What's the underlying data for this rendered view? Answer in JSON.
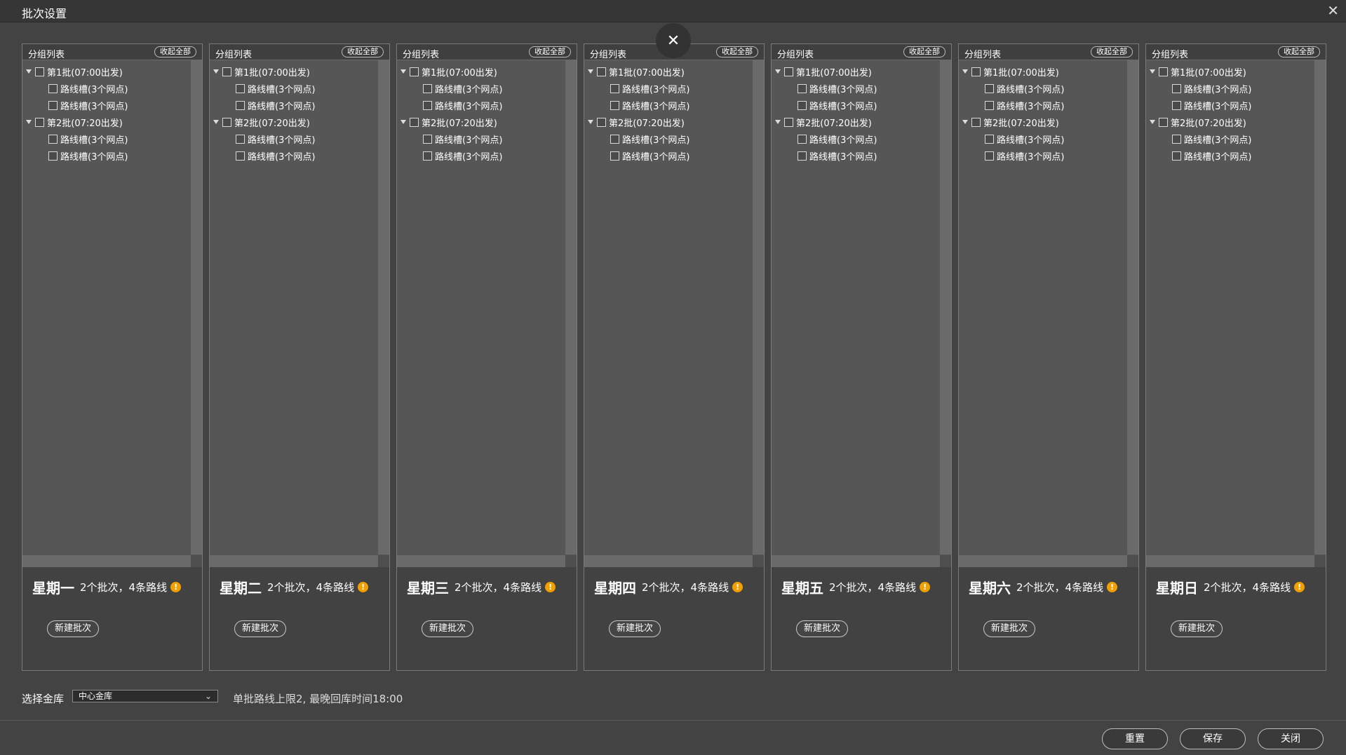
{
  "window": {
    "title": "批次设置",
    "close_glyph": "✕",
    "center_close_glyph": "✕"
  },
  "days": [
    {
      "header_title": "分组列表",
      "collapse_label": "收起全部",
      "batches": [
        {
          "label": "第1批(07:00出发)",
          "routes": [
            "路线槽(3个网点)",
            "路线槽(3个网点)"
          ]
        },
        {
          "label": "第2批(07:20出发)",
          "routes": [
            "路线槽(3个网点)",
            "路线槽(3个网点)"
          ]
        }
      ],
      "day_name": "星期一",
      "summary": "2个批次，4条路线",
      "info_icon": "!",
      "new_batch_label": "新建批次"
    },
    {
      "header_title": "分组列表",
      "collapse_label": "收起全部",
      "batches": [
        {
          "label": "第1批(07:00出发)",
          "routes": [
            "路线槽(3个网点)",
            "路线槽(3个网点)"
          ]
        },
        {
          "label": "第2批(07:20出发)",
          "routes": [
            "路线槽(3个网点)",
            "路线槽(3个网点)"
          ]
        }
      ],
      "day_name": "星期二",
      "summary": "2个批次，4条路线",
      "info_icon": "!",
      "new_batch_label": "新建批次"
    },
    {
      "header_title": "分组列表",
      "collapse_label": "收起全部",
      "batches": [
        {
          "label": "第1批(07:00出发)",
          "routes": [
            "路线槽(3个网点)",
            "路线槽(3个网点)"
          ]
        },
        {
          "label": "第2批(07:20出发)",
          "routes": [
            "路线槽(3个网点)",
            "路线槽(3个网点)"
          ]
        }
      ],
      "day_name": "星期三",
      "summary": "2个批次，4条路线",
      "info_icon": "!",
      "new_batch_label": "新建批次"
    },
    {
      "header_title": "分组列表",
      "collapse_label": "收起全部",
      "batches": [
        {
          "label": "第1批(07:00出发)",
          "routes": [
            "路线槽(3个网点)",
            "路线槽(3个网点)"
          ]
        },
        {
          "label": "第2批(07:20出发)",
          "routes": [
            "路线槽(3个网点)",
            "路线槽(3个网点)"
          ]
        }
      ],
      "day_name": "星期四",
      "summary": "2个批次，4条路线",
      "info_icon": "!",
      "new_batch_label": "新建批次"
    },
    {
      "header_title": "分组列表",
      "collapse_label": "收起全部",
      "batches": [
        {
          "label": "第1批(07:00出发)",
          "routes": [
            "路线槽(3个网点)",
            "路线槽(3个网点)"
          ]
        },
        {
          "label": "第2批(07:20出发)",
          "routes": [
            "路线槽(3个网点)",
            "路线槽(3个网点)"
          ]
        }
      ],
      "day_name": "星期五",
      "summary": "2个批次，4条路线",
      "info_icon": "!",
      "new_batch_label": "新建批次"
    },
    {
      "header_title": "分组列表",
      "collapse_label": "收起全部",
      "batches": [
        {
          "label": "第1批(07:00出发)",
          "routes": [
            "路线槽(3个网点)",
            "路线槽(3个网点)"
          ]
        },
        {
          "label": "第2批(07:20出发)",
          "routes": [
            "路线槽(3个网点)",
            "路线槽(3个网点)"
          ]
        }
      ],
      "day_name": "星期六",
      "summary": "2个批次，4条路线",
      "info_icon": "!",
      "new_batch_label": "新建批次"
    },
    {
      "header_title": "分组列表",
      "collapse_label": "收起全部",
      "batches": [
        {
          "label": "第1批(07:00出发)",
          "routes": [
            "路线槽(3个网点)",
            "路线槽(3个网点)"
          ]
        },
        {
          "label": "第2批(07:20出发)",
          "routes": [
            "路线槽(3个网点)",
            "路线槽(3个网点)"
          ]
        }
      ],
      "day_name": "星期日",
      "summary": "2个批次，4条路线",
      "info_icon": "!",
      "new_batch_label": "新建批次"
    }
  ],
  "bottom": {
    "vault_label": "选择金库",
    "vault_value": "中心金库",
    "vault_chevron": "⌄",
    "limit_note": "单批路线上限2, 最晚回库时间18:00"
  },
  "footer": {
    "reset_label": "重置",
    "save_label": "保存",
    "close_label": "关闭"
  },
  "colors": {
    "accent_info": "#f0a000",
    "background": "#434343"
  }
}
